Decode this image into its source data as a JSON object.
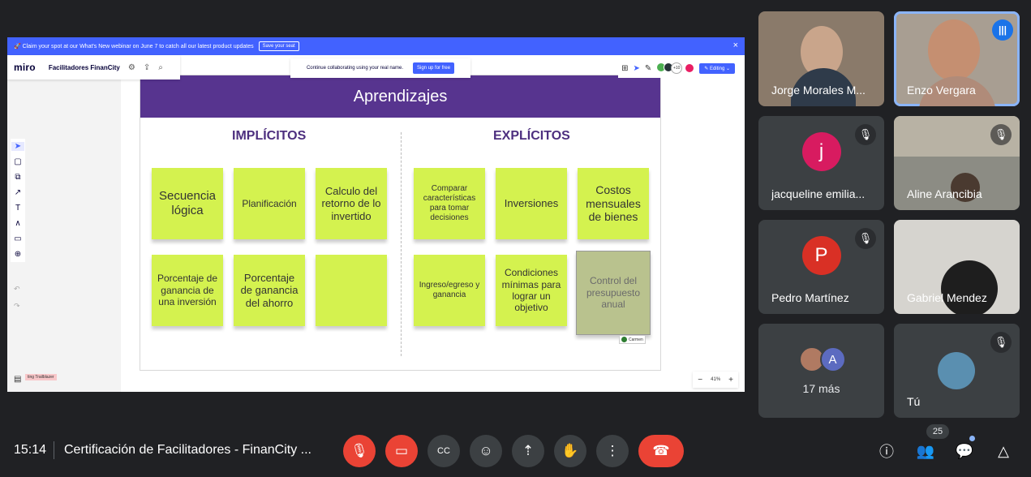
{
  "meet": {
    "clock": "15:14",
    "meeting_title": "Certificación de Facilitadores - FinanCity ...",
    "people_count": "25",
    "participants": [
      {
        "name": "Jorge Morales M...",
        "initial": ""
      },
      {
        "name": "Enzo Vergara",
        "initial": ""
      },
      {
        "name": "jacqueline emilia...",
        "initial": "j",
        "color": "#d81b60"
      },
      {
        "name": "Aline Arancibia",
        "initial": ""
      },
      {
        "name": "Pedro Martínez",
        "initial": "P",
        "color": "#d93025"
      },
      {
        "name": "Gabriel Mendez",
        "initial": ""
      },
      {
        "name": "17 más",
        "initial": "A"
      },
      {
        "name": "Tú",
        "initial": ""
      }
    ],
    "speaking_badge": "ZS"
  },
  "miro": {
    "banner_text": "🚀 Claim your spot at our What's New webinar on June 7 to catch all our latest product updates",
    "banner_cta": "Save your seat",
    "logo": "miro",
    "board_name": "Facilitadores FinanCity",
    "collab_text": "Continue collaborating using your real name.",
    "signup_label": "Sign up for free",
    "others_count": "+10",
    "editing_label": "Editing",
    "frame_label": "ting Trailblazer",
    "zoom_level": "41%",
    "cursor_label": "Carmen"
  },
  "slide": {
    "title": "Aprendizajes",
    "left_heading": "IMPLÍCITOS",
    "right_heading": "EXPLÍCITOS",
    "left_notes": [
      "Secuencia lógica",
      "Planificación",
      "Calculo del retorno de lo invertido",
      "Porcentaje de ganancia de una inversión",
      "Porcentaje de ganancia del ahorro",
      ""
    ],
    "right_notes": [
      "Comparar características para tomar decisiones",
      "Inversiones",
      "Costos mensuales de bienes",
      "Ingreso/egreso y ganancia",
      "Condiciones mínimas para lograr un objetivo",
      "Control del presupuesto anual"
    ]
  },
  "colors": {
    "meet_bg": "#202124",
    "tile_bg": "#3c4043",
    "hangup": "#ea4335",
    "slide_header": "#57348f",
    "sticky": "#d4f24f",
    "miro_blue": "#4262ff"
  }
}
